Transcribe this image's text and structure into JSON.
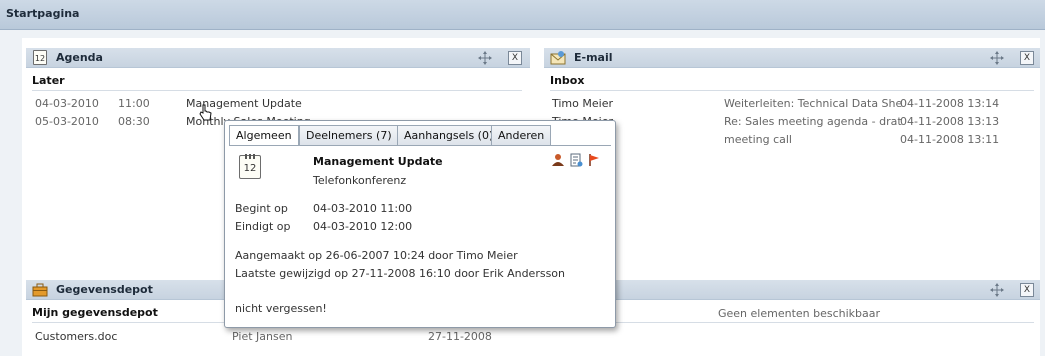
{
  "window": {
    "title": "Startpagina"
  },
  "agenda": {
    "title": "Agenda",
    "icon": "calendar-icon",
    "icon_day": "12",
    "section": "Later",
    "items": [
      {
        "date": "04-03-2010",
        "time": "11:00",
        "subject": "Management Update"
      },
      {
        "date": "05-03-2010",
        "time": "08:30",
        "subject": "Monthly Sales Meeting"
      }
    ]
  },
  "email": {
    "title": "E-mail",
    "icon": "mail-icon",
    "section": "Inbox",
    "items": [
      {
        "from": "Timo Meier",
        "subject": "Weiterleiten: Technical Data She",
        "date": "04-11-2008 13:14"
      },
      {
        "from": "Timo Meier",
        "subject": "Re: Sales meeting agenda - drat",
        "date": "04-11-2008 13:13"
      },
      {
        "from": "",
        "subject": "meeting call",
        "date": "04-11-2008 13:11"
      }
    ]
  },
  "depot": {
    "title": "Gegevensdepot",
    "icon": "briefcase-icon",
    "section": "Mijn gegevensdepot",
    "items": [
      {
        "name": "Customers.doc",
        "owner": "Piet Jansen",
        "date": "27-11-2008"
      }
    ],
    "right_empty": "Geen elementen beschikbaar"
  },
  "popup": {
    "tabs": [
      "Algemeen",
      "Deelnemers (7)",
      "Aanhangsels (0)",
      "Anderen"
    ],
    "active_tab": "Algemeen",
    "title": "Management Update",
    "location": "Telefonkonferenz",
    "icon_day": "12",
    "begins_label": "Begint op",
    "begins_value": "04-03-2010 11:00",
    "ends_label": "Eindigt op",
    "ends_value": "04-03-2010 12:00",
    "created": "Aangemaakt op 26-06-2007 10:24 door Timo Meier",
    "modified": "Laatste gewijzigd op 27-11-2008 16:10 door Erik Andersson",
    "note": "nicht vergessen!",
    "action_icons": [
      "participants-icon",
      "details-icon",
      "flag-icon"
    ]
  },
  "colors": {
    "accent": "#c7d3e0",
    "flag": "#e8491d"
  }
}
